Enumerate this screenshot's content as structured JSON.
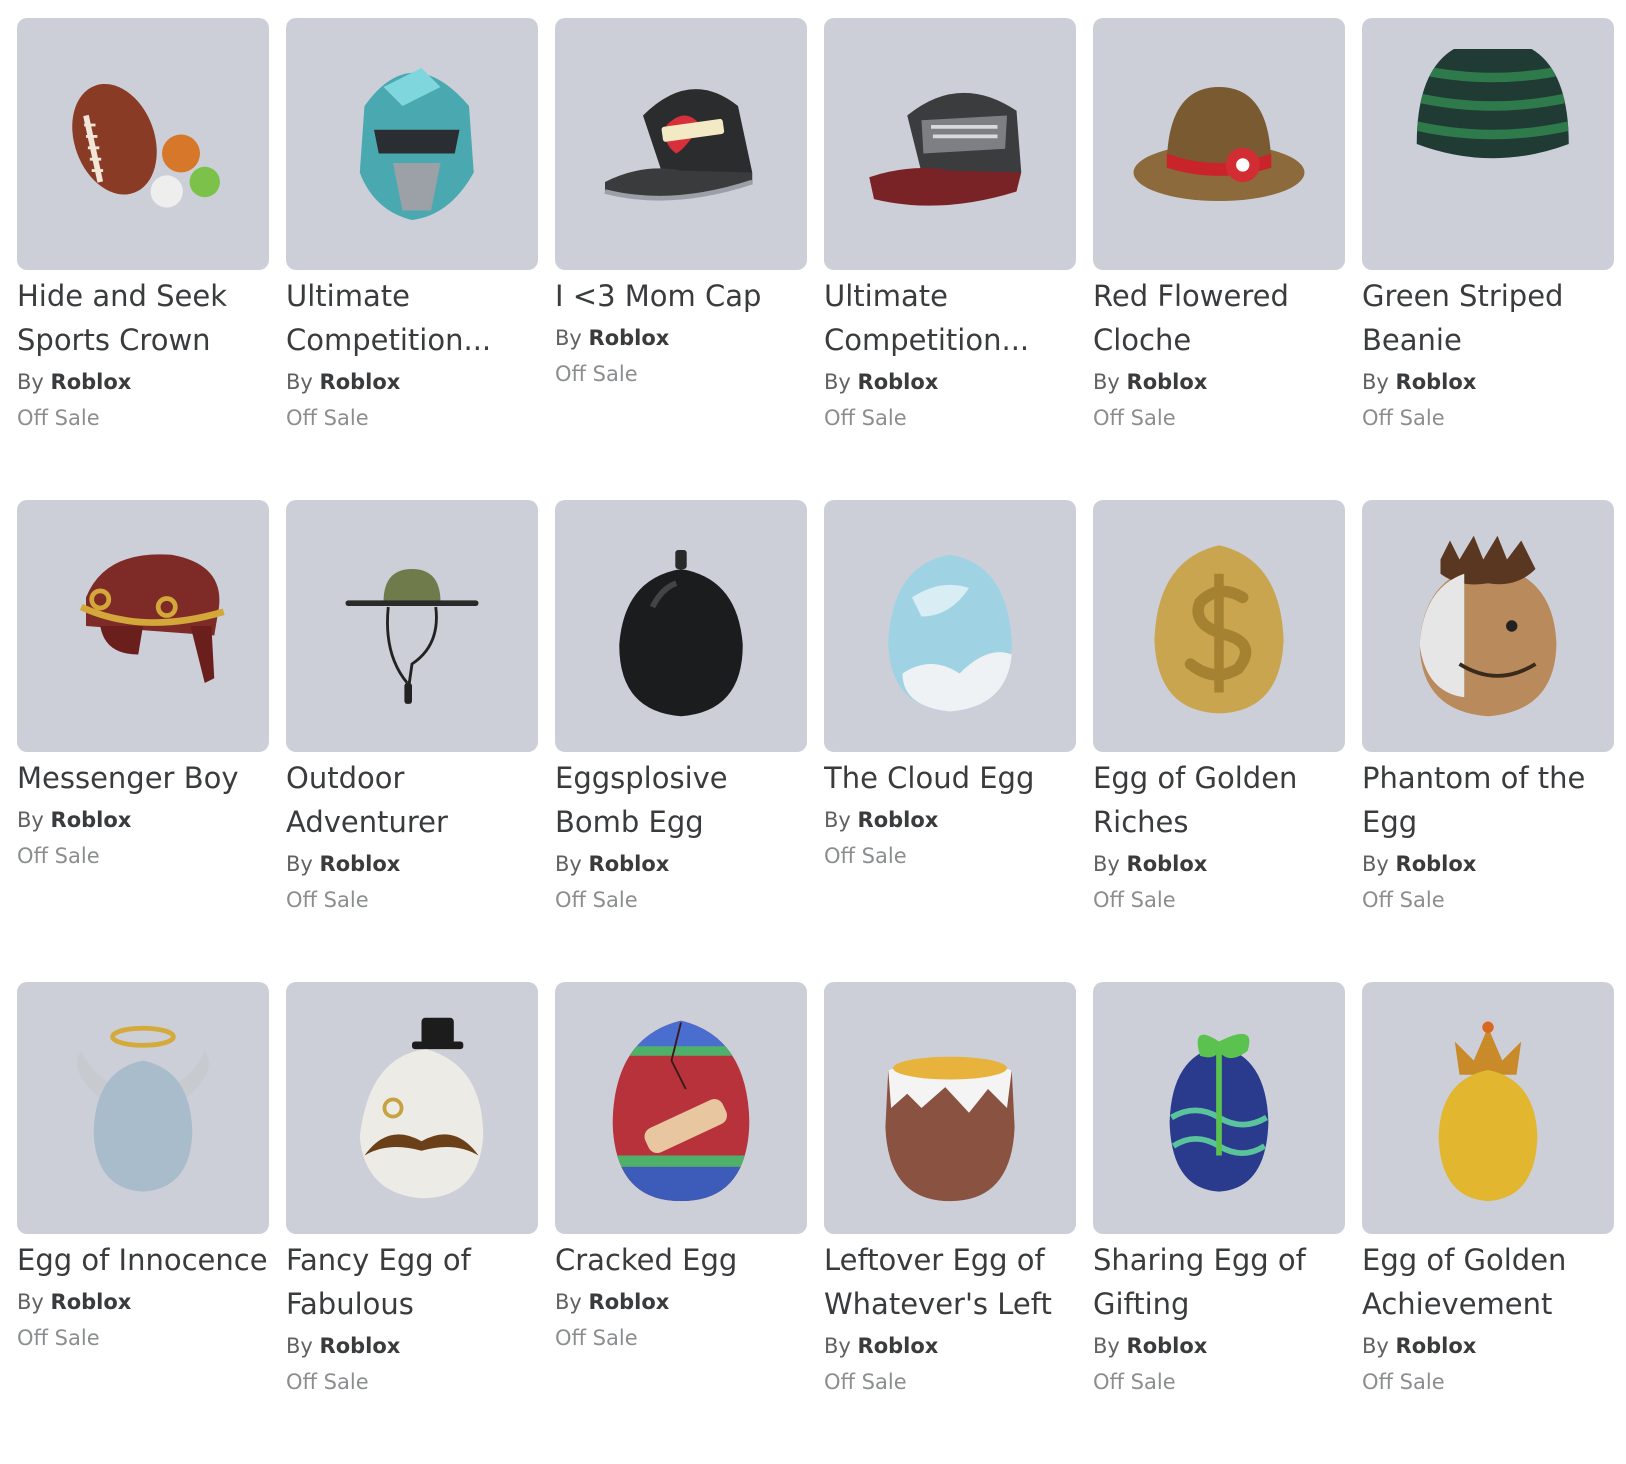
{
  "items": [
    {
      "name": "Hide and Seek Sports Crown",
      "by": "By",
      "creator": "Roblox",
      "status": "Off Sale",
      "icon": "sports-crown-icon"
    },
    {
      "name": "Ultimate Competition...",
      "by": "By",
      "creator": "Roblox",
      "status": "Off Sale",
      "icon": "helmet-icon"
    },
    {
      "name": "I <3 Mom Cap",
      "by": "By",
      "creator": "Roblox",
      "status": "Off Sale",
      "icon": "cap-icon"
    },
    {
      "name": "Ultimate Competition...",
      "by": "By",
      "creator": "Roblox",
      "status": "Off Sale",
      "icon": "cap-icon"
    },
    {
      "name": "Red Flowered Cloche",
      "by": "By",
      "creator": "Roblox",
      "status": "Off Sale",
      "icon": "cloche-hat-icon"
    },
    {
      "name": "Green Striped Beanie",
      "by": "By",
      "creator": "Roblox",
      "status": "Off Sale",
      "icon": "beanie-icon"
    },
    {
      "name": "Messenger Boy",
      "by": "By",
      "creator": "Roblox",
      "status": "Off Sale",
      "icon": "messenger-hat-icon"
    },
    {
      "name": "Outdoor Adventurer",
      "by": "By",
      "creator": "Roblox",
      "status": "Off Sale",
      "icon": "bucket-hat-icon"
    },
    {
      "name": "Eggsplosive Bomb Egg",
      "by": "By",
      "creator": "Roblox",
      "status": "Off Sale",
      "icon": "bomb-egg-icon"
    },
    {
      "name": "The Cloud Egg",
      "by": "By",
      "creator": "Roblox",
      "status": "Off Sale",
      "icon": "cloud-egg-icon"
    },
    {
      "name": "Egg of Golden Riches",
      "by": "By",
      "creator": "Roblox",
      "status": "Off Sale",
      "icon": "dollar-egg-icon"
    },
    {
      "name": "Phantom of the Egg",
      "by": "By",
      "creator": "Roblox",
      "status": "Off Sale",
      "icon": "phantom-egg-icon"
    },
    {
      "name": "Egg of Innocence",
      "by": "By",
      "creator": "Roblox",
      "status": "Off Sale",
      "icon": "angel-egg-icon"
    },
    {
      "name": "Fancy Egg of Fabulous",
      "by": "By",
      "creator": "Roblox",
      "status": "Off Sale",
      "icon": "fancy-egg-icon"
    },
    {
      "name": "Cracked Egg",
      "by": "By",
      "creator": "Roblox",
      "status": "Off Sale",
      "icon": "cracked-egg-icon"
    },
    {
      "name": "Leftover Egg of Whatever's Left",
      "by": "By",
      "creator": "Roblox",
      "status": "Off Sale",
      "icon": "leftover-egg-icon"
    },
    {
      "name": "Sharing Egg of Gifting",
      "by": "By",
      "creator": "Roblox",
      "status": "Off Sale",
      "icon": "gift-egg-icon"
    },
    {
      "name": "Egg of Golden Achievement",
      "by": "By",
      "creator": "Roblox",
      "status": "Off Sale",
      "icon": "crown-egg-icon"
    }
  ],
  "colors": {
    "thumb_bg": "#cdcfd8",
    "title_text": "#393b3d",
    "muted_text": "#8b8d8f"
  }
}
